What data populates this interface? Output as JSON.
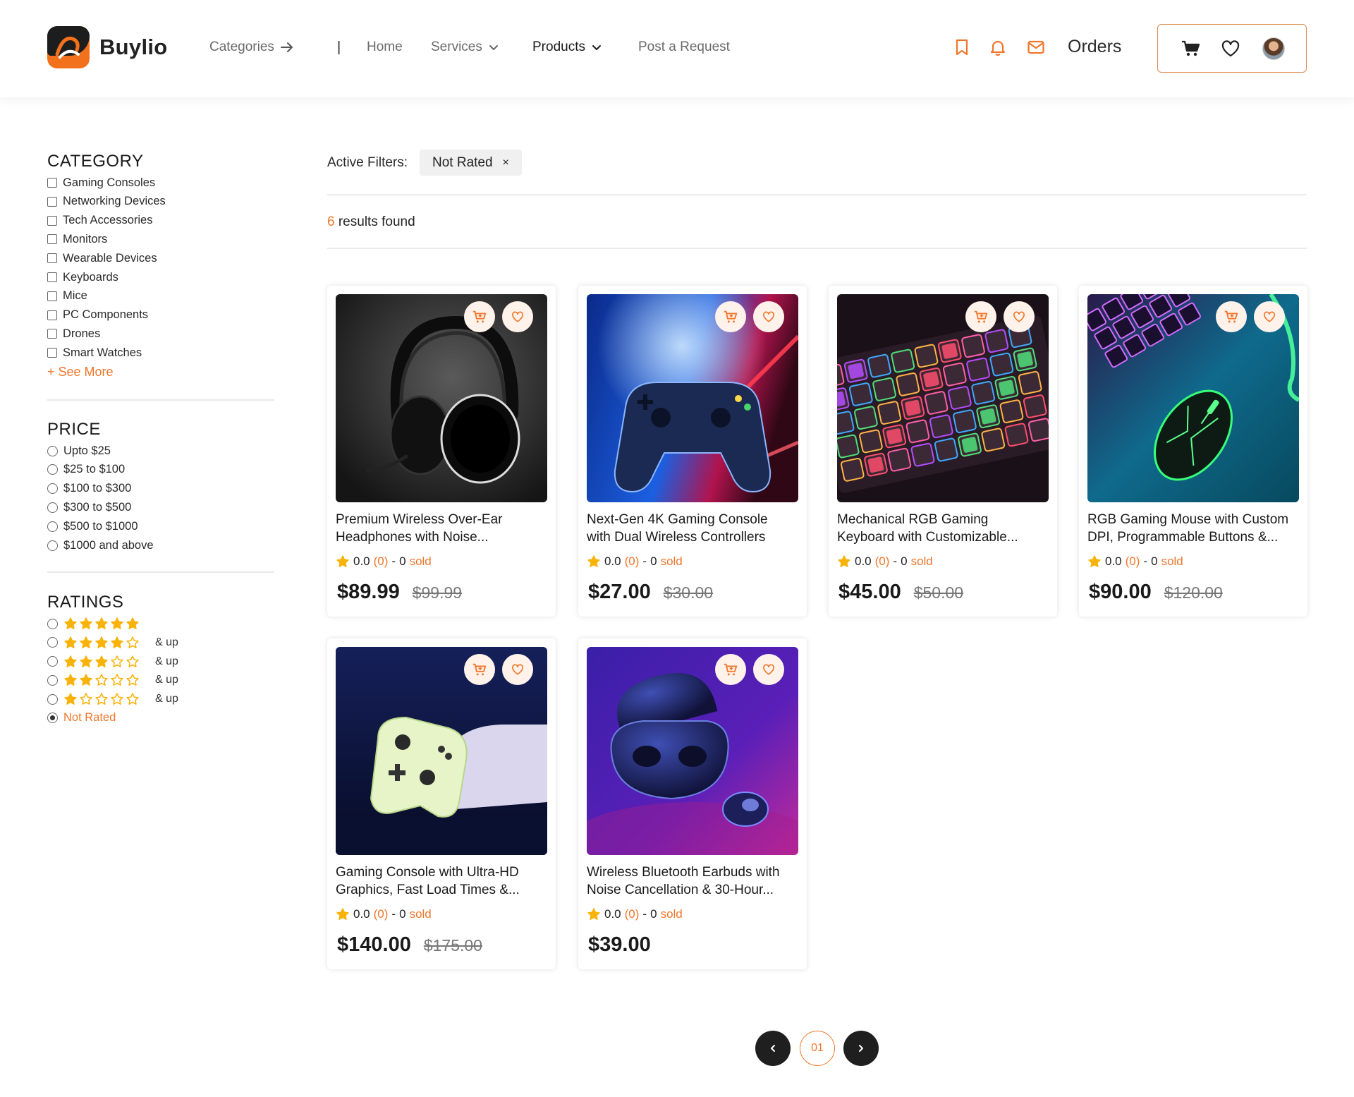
{
  "brand": {
    "name": "Buylio"
  },
  "nav": {
    "categories": "Categories",
    "separator": "|",
    "home": "Home",
    "services": "Services",
    "products": "Products",
    "post_request": "Post a Request",
    "orders": "Orders"
  },
  "header_icons": [
    "bookmark-icon",
    "bell-icon",
    "mail-icon",
    "cart-icon",
    "heart-icon",
    "avatar"
  ],
  "sidebar": {
    "category_title": "CATEGORY",
    "categories": [
      "Gaming Consoles",
      "Networking Devices",
      "Tech Accessories",
      "Monitors",
      "Wearable Devices",
      "Keyboards",
      "Mice",
      "PC Components",
      "Drones",
      "Smart Watches"
    ],
    "see_more": "+ See More",
    "price_title": "PRICE",
    "prices": [
      "Upto $25",
      "$25 to $100",
      "$100 to $300",
      "$300 to $500",
      "$500 to $1000",
      "$1000 and above"
    ],
    "ratings_title": "RATINGS",
    "ratings": [
      {
        "stars": 5,
        "suffix": ""
      },
      {
        "stars": 4,
        "suffix": "& up"
      },
      {
        "stars": 3,
        "suffix": "& up"
      },
      {
        "stars": 2,
        "suffix": "& up"
      },
      {
        "stars": 1,
        "suffix": "& up"
      }
    ],
    "not_rated": "Not Rated",
    "selected_rating": "Not Rated"
  },
  "filters": {
    "label": "Active Filters:",
    "chips": [
      {
        "label": "Not Rated",
        "remove": "×"
      }
    ]
  },
  "results": {
    "count": "6",
    "label": " results found"
  },
  "products": [
    {
      "title_line1": "Premium Wireless Over-Ear",
      "title_line2": "Headphones with Noise...",
      "rating": "0.0",
      "reviews": "(0)",
      "dash": "-",
      "sold_count": "0",
      "sold_label": "sold",
      "price": "$89.99",
      "old_price": "$99.99",
      "image": "headphones"
    },
    {
      "title_line1": "Next-Gen 4K Gaming Console",
      "title_line2": "with Dual Wireless Controllers",
      "rating": "0.0",
      "reviews": "(0)",
      "dash": "-",
      "sold_count": "0",
      "sold_label": "sold",
      "price": "$27.00",
      "old_price": "$30.00",
      "image": "gamepad"
    },
    {
      "title_line1": "Mechanical RGB Gaming",
      "title_line2": "Keyboard with Customizable...",
      "rating": "0.0",
      "reviews": "(0)",
      "dash": "-",
      "sold_count": "0",
      "sold_label": "sold",
      "price": "$45.00",
      "old_price": "$50.00",
      "image": "keyboard"
    },
    {
      "title_line1": "RGB Gaming Mouse with Custom",
      "title_line2": "DPI, Programmable Buttons &...",
      "rating": "0.0",
      "reviews": "(0)",
      "dash": "-",
      "sold_count": "0",
      "sold_label": "sold",
      "price": "$90.00",
      "old_price": "$120.00",
      "image": "mouse"
    },
    {
      "title_line1": "Gaming Console with Ultra-HD",
      "title_line2": "Graphics, Fast Load Times &...",
      "rating": "0.0",
      "reviews": "(0)",
      "dash": "-",
      "sold_count": "0",
      "sold_label": "sold",
      "price": "$140.00",
      "old_price": "$175.00",
      "image": "controller"
    },
    {
      "title_line1": "Wireless Bluetooth Earbuds with",
      "title_line2": "Noise Cancellation & 30-Hour...",
      "rating": "0.0",
      "reviews": "(0)",
      "dash": "-",
      "sold_count": "0",
      "sold_label": "sold",
      "price": "$39.00",
      "old_price": "",
      "image": "earbuds"
    }
  ],
  "pagination": {
    "prev": "‹",
    "current": "01",
    "next": "›"
  },
  "colors": {
    "accent": "#f0762b",
    "star": "#f9b208",
    "dark": "#1f1f1f"
  }
}
